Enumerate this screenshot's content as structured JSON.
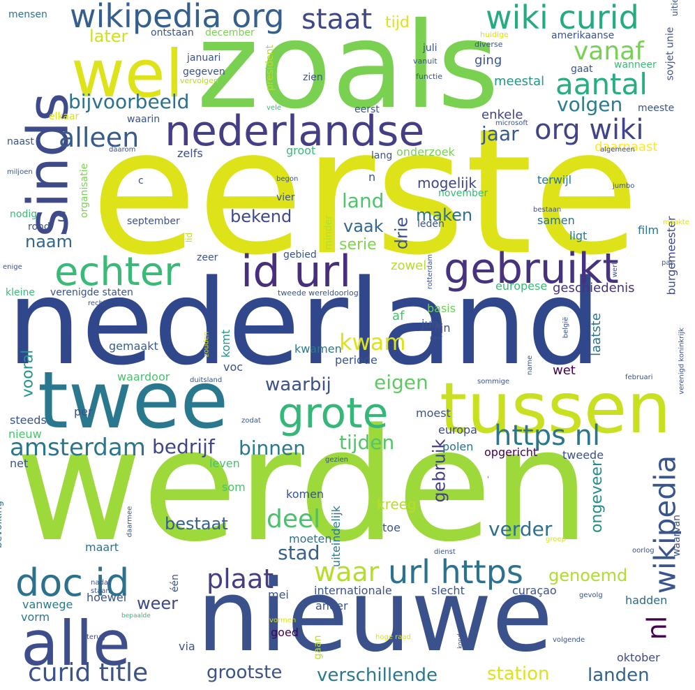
{
  "words": [
    {
      "text": "eerste",
      "color": "#dde318"
    },
    {
      "text": "nederland",
      "color": "#31478b"
    },
    {
      "text": "werden",
      "color": "#9dd93b"
    },
    {
      "text": "zoals",
      "color": "#7ad151"
    },
    {
      "text": "nieuwe",
      "color": "#3b518b"
    },
    {
      "text": "twee",
      "color": "#2a788e"
    },
    {
      "text": "tussen",
      "color": "#c8e020"
    },
    {
      "text": "alle",
      "color": "#3d4e8a"
    },
    {
      "text": "sinds",
      "color": "#3e4a89"
    },
    {
      "text": "wel",
      "color": "#dde318"
    },
    {
      "text": "nederlandse",
      "color": "#433e85"
    },
    {
      "text": "gebruikt",
      "color": "#46327e"
    },
    {
      "text": "id url",
      "color": "#472f7d"
    },
    {
      "text": "grote",
      "color": "#35b779"
    },
    {
      "text": "echter",
      "color": "#3aba76"
    },
    {
      "text": "doc id",
      "color": "#2c718e"
    },
    {
      "text": "wikipedia org",
      "color": "#355f8d"
    },
    {
      "text": "wiki curid",
      "color": "#25ab82"
    },
    {
      "text": "org wiki",
      "color": "#414487"
    },
    {
      "text": "aantal",
      "color": "#26ad81"
    },
    {
      "text": "alleen",
      "color": "#375b8d"
    },
    {
      "text": "staat",
      "color": "#3f4889"
    },
    {
      "text": "vanaf",
      "color": "#75d054"
    },
    {
      "text": "url https",
      "color": "#2c728e"
    },
    {
      "text": "https nl",
      "color": "#2a768e"
    },
    {
      "text": "wikipedia",
      "color": "#39558c"
    },
    {
      "text": "nl",
      "color": "#440154"
    },
    {
      "text": "plaat",
      "color": "#433e85"
    },
    {
      "text": "waar",
      "color": "#b5de2b"
    },
    {
      "text": "curid title",
      "color": "#3b528b"
    },
    {
      "text": "amsterdam",
      "color": "#2a768e"
    },
    {
      "text": "deel",
      "color": "#4ac16d"
    },
    {
      "text": "bijvoorbeeld",
      "color": "#2d708e"
    },
    {
      "text": "volgen",
      "color": "#287d8e"
    },
    {
      "text": "jaar",
      "color": "#375a8c"
    },
    {
      "text": "land",
      "color": "#4ec36b"
    },
    {
      "text": "kwam",
      "color": "#dde318"
    },
    {
      "text": "eigen",
      "color": "#5ec962"
    },
    {
      "text": "tijden",
      "color": "#52c569"
    },
    {
      "text": "bedrijf",
      "color": "#3f4788"
    },
    {
      "text": "binnen",
      "color": "#2a788e"
    },
    {
      "text": "waarbij",
      "color": "#3b518b"
    },
    {
      "text": "genoemd",
      "color": "#b0dd2f"
    },
    {
      "text": "bestaat",
      "color": "#355f8d"
    },
    {
      "text": "verder",
      "color": "#2d708e"
    },
    {
      "text": "stad",
      "color": "#34618d"
    },
    {
      "text": "grootste",
      "color": "#3b528b"
    },
    {
      "text": "verschillende",
      "color": "#2a788e"
    },
    {
      "text": "station",
      "color": "#dde318"
    },
    {
      "text": "landen",
      "color": "#33638d"
    },
    {
      "text": "weer",
      "color": "#3e4989"
    },
    {
      "text": "later",
      "color": "#cde11d"
    },
    {
      "text": "naam",
      "color": "#31668e"
    },
    {
      "text": "vaak",
      "color": "#31688e"
    },
    {
      "text": "serie",
      "color": "#81d34d"
    },
    {
      "text": "bekend",
      "color": "#3e4a89"
    },
    {
      "text": "maken",
      "color": "#2c728e"
    },
    {
      "text": "drie",
      "color": "#3b528b"
    },
    {
      "text": "mogelijk",
      "color": "#3f4788"
    },
    {
      "text": "gebruik",
      "color": "#433e85"
    },
    {
      "text": "ongeveer",
      "color": "#21908d"
    },
    {
      "text": "kreeg",
      "color": "#b8de29"
    },
    {
      "text": "vooral",
      "color": "#1f978b"
    },
    {
      "text": "s",
      "color": "#3b528b"
    },
    {
      "text": "tijd",
      "color": "#dde318"
    },
    {
      "text": "ging",
      "color": "#3b528b"
    },
    {
      "text": "meestal",
      "color": "#1f988b"
    },
    {
      "text": "enkele",
      "color": "#414487"
    },
    {
      "text": "zelfs",
      "color": "#3e4c8a"
    },
    {
      "text": "groot",
      "color": "#3aba76"
    },
    {
      "text": "onderzoek",
      "color": "#7ad151"
    },
    {
      "text": "daarnaast",
      "color": "#fde725"
    },
    {
      "text": "terwijl",
      "color": "#2a778e"
    },
    {
      "text": "film",
      "color": "#2c728e"
    },
    {
      "text": "burgemeester",
      "color": "#3e4a89"
    },
    {
      "text": "ligt",
      "color": "#2a788e"
    },
    {
      "text": "samen",
      "color": "#2c728e"
    },
    {
      "text": "geschiedenis",
      "color": "#46327e"
    },
    {
      "text": "europese",
      "color": "#3aba76"
    },
    {
      "text": "zowel",
      "color": "#b5de2b"
    },
    {
      "text": "basis",
      "color": "#6ccd5a"
    },
    {
      "text": "af",
      "color": "#4ac16d"
    },
    {
      "text": "juni",
      "color": "#3b528b"
    },
    {
      "text": "lijn",
      "color": "#3e4a89"
    },
    {
      "text": "laatste",
      "color": "#2c728e"
    },
    {
      "text": "wet",
      "color": "#440154"
    },
    {
      "text": "komt",
      "color": "#1f988b"
    },
    {
      "text": "kwamen",
      "color": "#2a778e"
    },
    {
      "text": "periode",
      "color": "#3b528b"
    },
    {
      "text": "gemaakt",
      "color": "#355f8d"
    },
    {
      "text": "voc",
      "color": "#3b528b"
    },
    {
      "text": "waardoor",
      "color": "#4ac16d"
    },
    {
      "text": "eigen",
      "color": "#5ec962"
    },
    {
      "text": "moest",
      "color": "#3b528b"
    },
    {
      "text": "europa",
      "color": "#3e4a89"
    },
    {
      "text": "polen",
      "color": "#2d708e"
    },
    {
      "text": "opgericht",
      "color": "#440154"
    },
    {
      "text": "tweede",
      "color": "#3b528b"
    },
    {
      "text": "steeds",
      "color": "#3b528b"
    },
    {
      "text": "per",
      "color": "#3b528b"
    },
    {
      "text": "nieuw",
      "color": "#4ac16d"
    },
    {
      "text": "net",
      "color": "#3b528b"
    },
    {
      "text": "leven",
      "color": "#4ac16d"
    },
    {
      "text": "som",
      "color": "#4ac16d"
    },
    {
      "text": "komen",
      "color": "#3b528b"
    },
    {
      "text": "toe",
      "color": "#3b528b"
    },
    {
      "text": "moeten",
      "color": "#2c728e"
    },
    {
      "text": "uiteindelijk",
      "color": "#2a788e"
    },
    {
      "text": "maart",
      "color": "#2c728e"
    },
    {
      "text": "hoewel",
      "color": "#3b528b"
    },
    {
      "text": "mei",
      "color": "#3b528b"
    },
    {
      "text": "internationale",
      "color": "#3b528b"
    },
    {
      "text": "slecht",
      "color": "#3b528b"
    },
    {
      "text": "curaçao",
      "color": "#3b528b"
    },
    {
      "text": "hadden",
      "color": "#31688e"
    },
    {
      "text": "vanwege",
      "color": "#2a788e"
    },
    {
      "text": "vorm",
      "color": "#2a788e"
    },
    {
      "text": "ander",
      "color": "#3b528b"
    },
    {
      "text": "goed",
      "color": "#440154"
    },
    {
      "text": "via",
      "color": "#3b528b"
    },
    {
      "text": "oktober",
      "color": "#3e4a89"
    },
    {
      "text": "bevolking",
      "color": "#2a788e"
    },
    {
      "text": "waarvan",
      "color": "#3b528b"
    },
    {
      "text": "één",
      "color": "#3b528b"
    },
    {
      "text": "gaan",
      "color": "#b5de2b"
    },
    {
      "text": "mensen",
      "color": "#2c728e"
    },
    {
      "text": "ontstaan",
      "color": "#3b528b"
    },
    {
      "text": "december",
      "color": "#7ad151"
    },
    {
      "text": "januari",
      "color": "#3b528b"
    },
    {
      "text": "gegeven",
      "color": "#3b528b"
    },
    {
      "text": "president",
      "color": "#b5de2b"
    },
    {
      "text": "zien",
      "color": "#3b528b"
    },
    {
      "text": "eerst",
      "color": "#3b528b"
    },
    {
      "text": "waarin",
      "color": "#3b528b"
    },
    {
      "text": "elkaar",
      "color": "#dde318"
    },
    {
      "text": "naast",
      "color": "#3b528b"
    },
    {
      "text": "lang",
      "color": "#3b528b"
    },
    {
      "text": "organisatie",
      "color": "#7ad151"
    },
    {
      "text": "nodig",
      "color": "#3aba76"
    },
    {
      "text": "rond",
      "color": "#3b528b"
    },
    {
      "text": "september",
      "color": "#3b528b"
    },
    {
      "text": "lid",
      "color": "#b5de2b"
    },
    {
      "text": "vier",
      "color": "#3b528b"
    },
    {
      "text": "minder",
      "color": "#b5de2b"
    },
    {
      "text": "leden",
      "color": "#3b528b"
    },
    {
      "text": "november",
      "color": "#3aba76"
    },
    {
      "text": "gebied",
      "color": "#3b528b"
    },
    {
      "text": "zeer",
      "color": "#3b528b"
    },
    {
      "text": "kleine",
      "color": "#3aba76"
    },
    {
      "text": "verenigde staten",
      "color": "#3b528b"
    },
    {
      "text": "tweede wereldoorlog",
      "color": "#3b528b"
    },
    {
      "text": "amerikaanse",
      "color": "#3b528b"
    },
    {
      "text": "juli",
      "color": "#3b528b"
    },
    {
      "text": "gaat",
      "color": "#3b528b"
    },
    {
      "text": "wanneer",
      "color": "#3aba76"
    },
    {
      "text": "sovjet unie",
      "color": "#3b528b"
    },
    {
      "text": "uitie",
      "color": "#3b528b"
    },
    {
      "text": "functie",
      "color": "#3b528b"
    },
    {
      "text": "meeste",
      "color": "#3b528b"
    },
    {
      "text": "huidige",
      "color": "#dde318"
    },
    {
      "text": "diverse",
      "color": "#3b528b"
    },
    {
      "text": "vanuit",
      "color": "#3b528b"
    },
    {
      "text": "vervolgen",
      "color": "#b5de2b"
    },
    {
      "text": "vele",
      "color": "#3aba76"
    },
    {
      "text": "microsoft",
      "color": "#3b528b"
    },
    {
      "text": "algemeen",
      "color": "#3b528b"
    },
    {
      "text": "daarom",
      "color": "#3b528b"
    },
    {
      "text": "miljoen",
      "color": "#3b528b"
    },
    {
      "text": "c",
      "color": "#3b528b"
    },
    {
      "text": "begon",
      "color": "#3b528b"
    },
    {
      "text": "n",
      "color": "#3b528b"
    },
    {
      "text": "jumbo",
      "color": "#3b528b"
    },
    {
      "text": "bestaan",
      "color": "#3b528b"
    },
    {
      "text": "maakte",
      "color": "#dde318"
    },
    {
      "text": "enige",
      "color": "#3b528b"
    },
    {
      "text": "pas",
      "color": "#3b528b"
    },
    {
      "text": "werk",
      "color": "#3b528b"
    },
    {
      "text": "recht",
      "color": "#3b528b"
    },
    {
      "text": "rotterdam",
      "color": "#3b528b"
    },
    {
      "text": "zouden",
      "color": "#dde318"
    },
    {
      "text": "naar",
      "color": "#3b528b"
    },
    {
      "text": "belgië",
      "color": "#3b528b"
    },
    {
      "text": "verenigd koninkrijk",
      "color": "#3b528b"
    },
    {
      "text": "duitsland",
      "color": "#3b528b"
    },
    {
      "text": "sommige",
      "color": "#3b528b"
    },
    {
      "text": "februari",
      "color": "#3b528b"
    },
    {
      "text": "zodat",
      "color": "#3b528b"
    },
    {
      "text": "name",
      "color": "#3b528b"
    },
    {
      "text": "oorlog",
      "color": "#3b528b"
    },
    {
      "text": "gezien",
      "color": "#3b528b"
    },
    {
      "text": "daarmee",
      "color": "#3b528b"
    },
    {
      "text": "dienst",
      "color": "#3b528b"
    },
    {
      "text": "groep",
      "color": "#dde318"
    },
    {
      "text": "gevolg",
      "color": "#3b528b"
    },
    {
      "text": "nadat",
      "color": "#3b528b"
    },
    {
      "text": "staan",
      "color": "#3b528b"
    },
    {
      "text": "bepaalde",
      "color": "#3aba76"
    },
    {
      "text": "terug",
      "color": "#3b528b"
    },
    {
      "text": "vormen",
      "color": "#dde318"
    },
    {
      "text": "konden",
      "color": "#3b528b"
    },
    {
      "text": "hoge raad",
      "color": "#dde318"
    },
    {
      "text": "volgende",
      "color": "#3b528b"
    },
    {
      "text": "'",
      "color": "#3b528b"
    }
  ]
}
